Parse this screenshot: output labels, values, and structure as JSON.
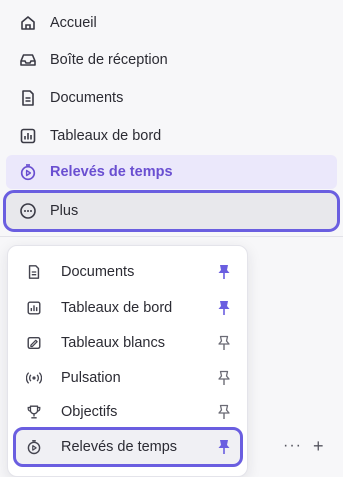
{
  "sidebar": {
    "items": [
      {
        "label": "Accueil",
        "icon": "home-icon"
      },
      {
        "label": "Boîte de réception",
        "icon": "inbox-icon"
      },
      {
        "label": "Documents",
        "icon": "document-icon"
      },
      {
        "label": "Tableaux de bord",
        "icon": "dashboard-icon"
      },
      {
        "label": "Relevés de temps",
        "icon": "timer-icon",
        "active": true
      },
      {
        "label": "Plus",
        "icon": "more-circle-icon"
      }
    ]
  },
  "popup": {
    "items": [
      {
        "label": "Documents",
        "icon": "document-icon",
        "pinned": true
      },
      {
        "label": "Tableaux de bord",
        "icon": "dashboard-icon",
        "pinned": true
      },
      {
        "label": "Tableaux blancs",
        "icon": "whiteboard-icon",
        "pinned": false
      },
      {
        "label": "Pulsation",
        "icon": "pulse-icon",
        "pinned": false
      },
      {
        "label": "Objectifs",
        "icon": "trophy-icon",
        "pinned": false
      },
      {
        "label": "Relevés de temps",
        "icon": "timer-icon",
        "pinned": true
      }
    ]
  },
  "actions": {
    "more": "···",
    "add": "+"
  },
  "colors": {
    "accent": "#6a4fd1",
    "highlight_border": "#6a5ee0",
    "pin_filled": "#6a5ee0",
    "pin_outline": "#6b6b75"
  }
}
